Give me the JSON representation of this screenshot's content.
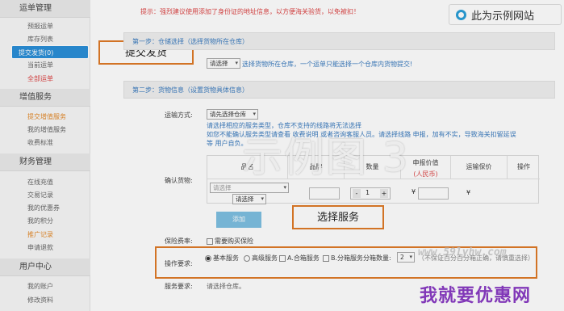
{
  "sidebar": {
    "sections": [
      {
        "title": "运单管理",
        "items": [
          "预报运单",
          "库存列表",
          "提交发货(0)",
          "当前运单",
          "全部运单"
        ]
      },
      {
        "title": "增值服务",
        "items": [
          "提交增值服务",
          "我的增值服务",
          "收费标准"
        ]
      },
      {
        "title": "财务管理",
        "items": [
          "在线充值",
          "交易记录",
          "我的优惠券",
          "我的积分",
          "推广记录",
          "申请退款"
        ]
      },
      {
        "title": "用户中心",
        "items": [
          "我的账户",
          "修改资料"
        ]
      }
    ]
  },
  "callouts": {
    "submit": "提交发货",
    "service": "选择服务"
  },
  "brand": {
    "label": "此为示例网站"
  },
  "notice": "提示：强烈建议使用添加了身份证的地址信息，以方便海关验货，以免被扣！",
  "step1": {
    "title": "第一步：仓储选择（选择货物所在仓库）",
    "select": "请选择",
    "hint": "选择货物所在仓库，一个运单只能选择一个仓库内货物提交!"
  },
  "step2": {
    "title": "第二步：货物信息（设置货物具体信息）",
    "transport_label": "运输方式:",
    "transport_select": "请先选择仓库",
    "transport_hint_1": "请选择相应的服务类型，仓库不支持的线路将无法选择",
    "transport_hint_2": "如您不能确认服务类型请查看 收费说明 或者咨询客服人员。请选择线路 申报，加有不实，导致海关扣留延误",
    "transport_hint_3": "等 用户自负。",
    "confirm_label": "确认货物:",
    "table_headers": [
      "品名",
      "品牌",
      "数量",
      "申报价值",
      "运输保价",
      "操作"
    ],
    "declared_sub": "(人民币)",
    "row_select_1": "请选择",
    "row_select_2": "请选择",
    "qty": "1",
    "currency": "¥",
    "currency_2": "¥",
    "add_button": "添加",
    "insurance_label": "保险费率:",
    "insurance_option": "需要购买保险",
    "ops_label": "操作要求:",
    "services": [
      "基本服务",
      "高级服务",
      "A.合箱服务",
      "B.分箱服务"
    ],
    "split_qty_label": "分箱数量:",
    "split_qty": "2",
    "split_note": "（不保证百分百分箱正确，请慎重选择）",
    "service_req_label": "服务要求:",
    "service_req_value": "请选择仓库。"
  },
  "watermark": "示例图 3",
  "site": "www.59lyhw.com",
  "slogan": "我就要优惠网"
}
